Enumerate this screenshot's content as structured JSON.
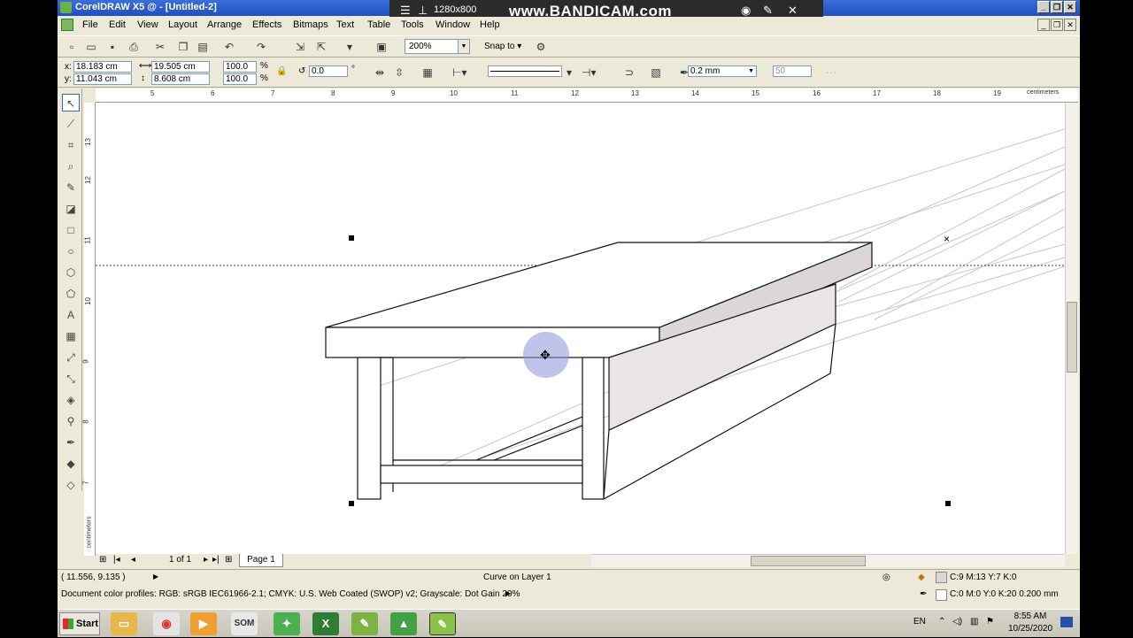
{
  "window": {
    "title": "CorelDRAW X5 @ - [Untitled-2]"
  },
  "recorder": {
    "resolution": "1280x800",
    "brand": "www.BANDICAM.com"
  },
  "menu": [
    "File",
    "Edit",
    "View",
    "Layout",
    "Arrange",
    "Effects",
    "Bitmaps",
    "Text",
    "Table",
    "Tools",
    "Window",
    "Help"
  ],
  "toolbar": {
    "zoom": "200%",
    "snap_label": "Snap to"
  },
  "property_bar": {
    "x_label": "x:",
    "x": "18.183 cm",
    "y_label": "y:",
    "y": "11.043 cm",
    "width": "19.505 cm",
    "height": "8.608 cm",
    "scale_w": "100.0",
    "scale_h": "100.0",
    "percent": "%",
    "rotation": "0.0",
    "degree": "°",
    "outline_width": "0.2 mm",
    "curve_smoothing": "50"
  },
  "ruler": {
    "unit": "centimeters",
    "h_labels": [
      "5",
      "6",
      "7",
      "8",
      "9",
      "10",
      "11",
      "12",
      "13",
      "14",
      "15",
      "16",
      "17",
      "18",
      "19"
    ],
    "v_labels": [
      "13",
      "12",
      "11",
      "10",
      "9",
      "8",
      "7"
    ],
    "v_unit": "centimeters"
  },
  "page_nav": {
    "counter": "1 of 1",
    "tab": "Page 1"
  },
  "status": {
    "coords": "( 11.556, 9.135 )",
    "object": "Curve on Layer 1",
    "profiles": "Document color profiles: RGB: sRGB IEC61966-2.1; CMYK: U.S. Web Coated (SWOP) v2; Grayscale: Dot Gain 20%",
    "fill": "C:9 M:13 Y:7 K:0",
    "outline": "C:0 M:0 Y:0 K:20  0.200 mm"
  },
  "taskbar": {
    "start": "Start",
    "lang": "EN",
    "time": "8:55 AM",
    "date": "10/25/2020",
    "apps": [
      "explorer-icon",
      "chrome-icon",
      "media-player-icon",
      "som-icon",
      "coreldraw-icon",
      "excel-icon",
      "corel-x5-icon",
      "sketchup-icon",
      "corel-active-icon"
    ],
    "som_label": "SOM"
  },
  "colors": {
    "accent": "#316ac5",
    "titlebar": "#1f4fbf",
    "side_fill": "#ddd6d8",
    "guide": "#1f3b8c"
  }
}
